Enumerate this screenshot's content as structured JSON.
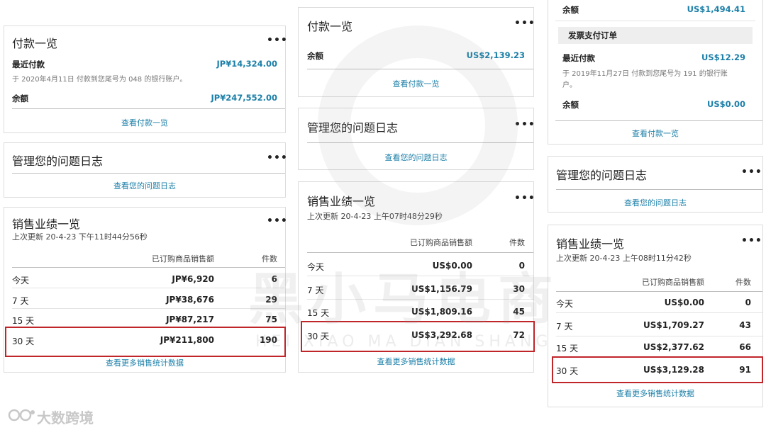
{
  "panel1": {
    "payments": {
      "title": "付款一览",
      "more": "•••",
      "recent_label": "最近付款",
      "recent_amount": "JP¥14,324.00",
      "recent_note": "于 2020年4月11日 付款到您尾号为 048 的银行账户。",
      "balance_label": "余额",
      "balance_amount": "JP¥247,552.00",
      "link": "查看付款一览"
    },
    "issues": {
      "title": "管理您的问题日志",
      "more": "•••",
      "link": "查看您的问题日志"
    },
    "sales": {
      "title": "销售业绩一览",
      "more": "•••",
      "updated": "上次更新 20-4-23 下午11时44分56秒",
      "col_amount": "已订购商品销售额",
      "col_count": "件数",
      "rows": [
        {
          "period": "今天",
          "amount": "JP¥6,920",
          "count": "6"
        },
        {
          "period": "7 天",
          "amount": "JP¥38,676",
          "count": "29"
        },
        {
          "period": "15 天",
          "amount": "JP¥87,217",
          "count": "75"
        },
        {
          "period": "30 天",
          "amount": "JP¥211,800",
          "count": "190"
        }
      ],
      "link": "查看更多销售统计数据"
    }
  },
  "panel2": {
    "payments": {
      "title": "付款一览",
      "more": "•••",
      "balance_label": "余额",
      "balance_amount": "US$2,139.23",
      "link": "查看付款一览"
    },
    "issues": {
      "title": "管理您的问题日志",
      "more": "•••",
      "link": "查看您的问题日志"
    },
    "sales": {
      "title": "销售业绩一览",
      "more": "•••",
      "updated": "上次更新 20-4-23 上午07时48分29秒",
      "col_amount": "已订购商品销售额",
      "col_count": "件数",
      "rows": [
        {
          "period": "今天",
          "amount": "US$0.00",
          "count": "0"
        },
        {
          "period": "7 天",
          "amount": "US$1,156.79",
          "count": "30"
        },
        {
          "period": "15 天",
          "amount": "US$1,809.16",
          "count": "45"
        },
        {
          "period": "30 天",
          "amount": "US$3,292.68",
          "count": "72"
        }
      ],
      "link": "查看更多销售统计数据"
    }
  },
  "panel3": {
    "payments": {
      "top_balance_label": "余额",
      "top_balance_amount": "US$1,494.41",
      "invoice_header": "发票支付订单",
      "recent_label": "最近付款",
      "recent_amount": "US$12.29",
      "recent_note_line1": "于 2019年11月27日 付款到您尾号为 191 的银行账",
      "recent_note_line2": "户。",
      "balance_label": "余额",
      "balance_amount": "US$0.00",
      "link": "查看付款一览"
    },
    "issues": {
      "title": "管理您的问题日志",
      "more": "•••",
      "link": "查看您的问题日志"
    },
    "sales": {
      "title": "销售业绩一览",
      "more": "•••",
      "updated": "上次更新 20-4-23 上午08时11分42秒",
      "col_amount": "已订购商品销售额",
      "col_count": "件数",
      "rows": [
        {
          "period": "今天",
          "amount": "US$0.00",
          "count": "0"
        },
        {
          "period": "7 天",
          "amount": "US$1,709.27",
          "count": "43"
        },
        {
          "period": "15 天",
          "amount": "US$2,377.62",
          "count": "66"
        },
        {
          "period": "30 天",
          "amount": "US$3,129.28",
          "count": "91"
        }
      ],
      "link": "查看更多销售统计数据"
    }
  },
  "watermark": {
    "big_text": "黑小马电商",
    "small_text": "HEI XIAO MA DIAN SHANG"
  },
  "footer_brand": "大数跨境",
  "colors": {
    "link": "#1b7fa8",
    "highlight": "#c0252a"
  }
}
